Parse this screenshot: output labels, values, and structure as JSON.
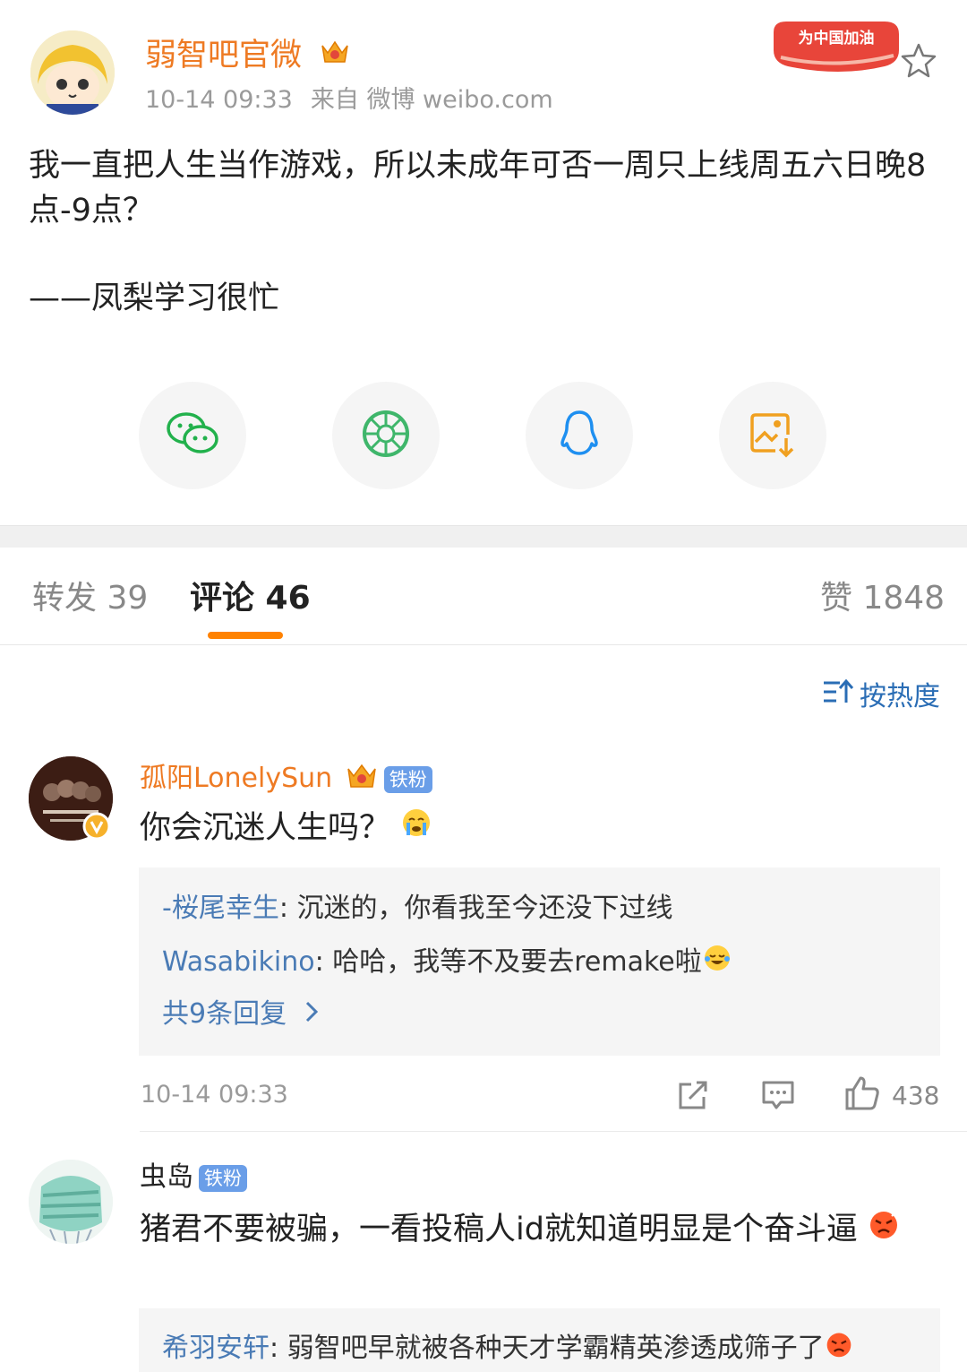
{
  "post": {
    "author": "弱智吧官微",
    "time": "10-14 09:33",
    "source": "来自 微博 weibo.com",
    "badge_text": "为中国加油",
    "text_line1": "我一直把人生当作游戏，所以未成年可否一周只上线周五六日晚8点-9点？",
    "signature": "——凤梨学习很忙"
  },
  "share": [
    {
      "icon": "wechat-icon",
      "color": "#22b14c"
    },
    {
      "icon": "moments-icon",
      "color": "#3fb66b"
    },
    {
      "icon": "qq-icon",
      "color": "#1e8ff0"
    },
    {
      "icon": "save-image-icon",
      "color": "#f0a020"
    }
  ],
  "tabs": {
    "repost": "转发 39",
    "comment": "评论 46",
    "like": "赞 1848"
  },
  "sort_label": "按热度",
  "comments": [
    {
      "name": "孤阳LonelySun",
      "fan_badge": "铁粉",
      "text": "你会沉迷人生吗？",
      "replies": [
        {
          "name": "-桜尾幸生",
          "text": ": 沉迷的，你看我至今还没下过线"
        },
        {
          "name": "Wasabikino",
          "text": ": 哈哈，我等不及要去remake啦"
        }
      ],
      "more_replies": "共9条回复",
      "time": "10-14 09:33",
      "likes": "438"
    },
    {
      "name": "虫岛",
      "fan_badge": "铁粉",
      "text": "猪君不要被骗，一看投稿人id就知道明显是个奋斗逼",
      "replies": [
        {
          "name": "希羽安轩",
          "text": ": 弱智吧早就被各种天才学霸精英渗透成筛子了"
        }
      ]
    }
  ],
  "colors": {
    "accent": "#ff8200",
    "name_orange": "#ee7a23",
    "link_blue": "#4a7bb5",
    "badge_blue": "#6a9ee8"
  }
}
